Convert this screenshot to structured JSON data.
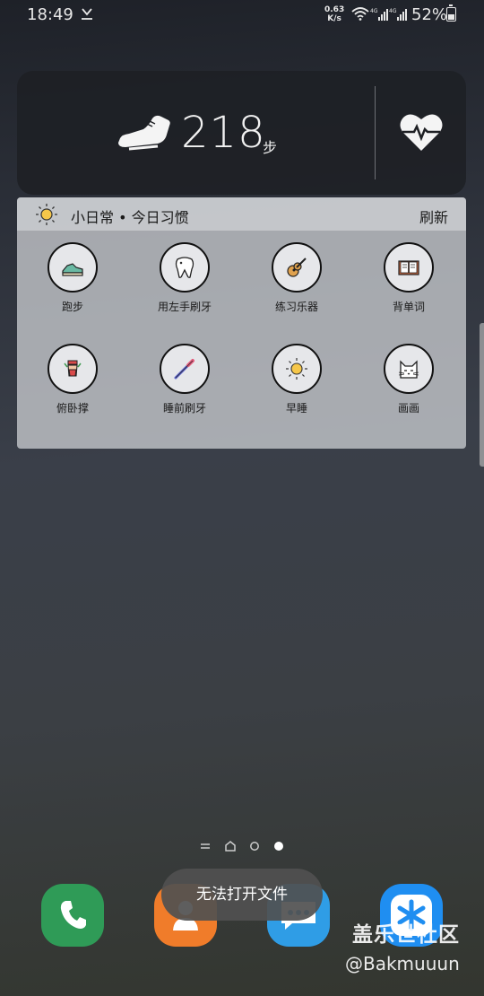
{
  "status_bar": {
    "time": "18:49",
    "net_speed_value": "0.63",
    "net_speed_unit": "K/s",
    "signal1_label": "4G",
    "signal2_label": "4G",
    "battery": "52%",
    "battery_level": 0.52
  },
  "step_widget": {
    "count": "218",
    "unit": "步",
    "icons": [
      "shoe-icon",
      "heart-pulse-icon"
    ]
  },
  "habits_widget": {
    "title": "小日常 • 今日习惯",
    "refresh_label": "刷新",
    "habits": [
      {
        "label": "跑步",
        "icon": "sneaker-icon"
      },
      {
        "label": "用左手刷牙",
        "icon": "tooth-icon"
      },
      {
        "label": "练习乐器",
        "icon": "guitar-icon"
      },
      {
        "label": "背单词",
        "icon": "book-icon"
      },
      {
        "label": "俯卧撑",
        "icon": "pushup-icon"
      },
      {
        "label": "睡前刷牙",
        "icon": "toothbrush-icon"
      },
      {
        "label": "早睡",
        "icon": "sun-icon"
      },
      {
        "label": "画画",
        "icon": "cat-icon"
      }
    ]
  },
  "page_indicator": {
    "pages": [
      "menu",
      "home",
      "dot",
      "dot-active"
    ],
    "active_index": 3
  },
  "dock": {
    "apps": [
      "phone-icon",
      "contacts-icon",
      "messages-icon",
      "app-icon"
    ],
    "colors": [
      "#2f9b57",
      "#f07c2a",
      "#2f9de6",
      "#1f8ef1"
    ]
  },
  "toast": {
    "message": "无法打开文件"
  },
  "watermark": {
    "line1": "盖乐世社区",
    "line2": "@Bakmuuun"
  }
}
